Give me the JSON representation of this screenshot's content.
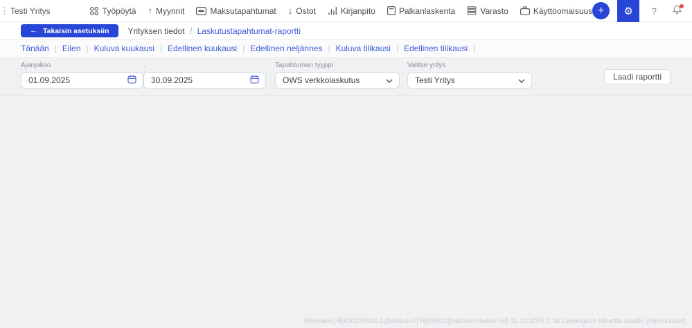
{
  "topbar": {
    "company": "Testi Yritys",
    "nav": [
      {
        "label": "Työpöytä",
        "icon": "dashboard-icon"
      },
      {
        "label": "Myynnit",
        "icon": "arrow-up-icon"
      },
      {
        "label": "Maksutapahtumat",
        "icon": "card-icon"
      },
      {
        "label": "Ostot",
        "icon": "arrow-down-icon"
      },
      {
        "label": "Kirjanpito",
        "icon": "bar-chart-icon"
      },
      {
        "label": "Palkanlaskenta",
        "icon": "document-icon"
      },
      {
        "label": "Varasto",
        "icon": "layers-icon"
      },
      {
        "label": "Käyttöomaisuus",
        "icon": "briefcase-icon"
      }
    ]
  },
  "glyphs": {
    "kebab": "⋮",
    "plus": "+",
    "gear": "⚙",
    "help": "?",
    "back_arrow": "←",
    "arrow_up": "↑",
    "arrow_down": "↓"
  },
  "toolbar": {
    "back_label": "Takaisin asetuksiin",
    "breadcrumb": {
      "parent": "Yrityksen tiedot",
      "separator": "/",
      "current": "Laskutustapahtumat-raportti"
    }
  },
  "quick_ranges": [
    "Tänään",
    "Eilen",
    "Kuluva kuukausi",
    "Edellinen kuukausi",
    "Edellinen neljännes",
    "Kuluva tilikausi",
    "Edellinen tilikausi"
  ],
  "quick_range_separator": "|",
  "form": {
    "period_label": "Ajanjakso",
    "period_end_label": ".",
    "date_from": "01.09.2025",
    "date_to": "30.09.2025",
    "type_label": "Tapahtuman tyyppi",
    "type_value": "OWS verkkolaskutus",
    "company_label": "Valitse yritys",
    "company_value": "Testi Yritys",
    "submit_label": "Laadi raportti"
  },
  "footer": {
    "build_info": "S[release] B[#20250916.1@aktiva-ci] R[#3502@aktiva-release-cd] 01.10.2025 1:34 Liikekirjurin tilikartta (kaikki yhtiömuodot)"
  },
  "colors": {
    "accent_blue": "#2746d6",
    "link_blue": "#3d5bd9",
    "cart_red": "#f76f6f",
    "notification_red": "#f2453d",
    "page_background": "#f0f1f3"
  }
}
